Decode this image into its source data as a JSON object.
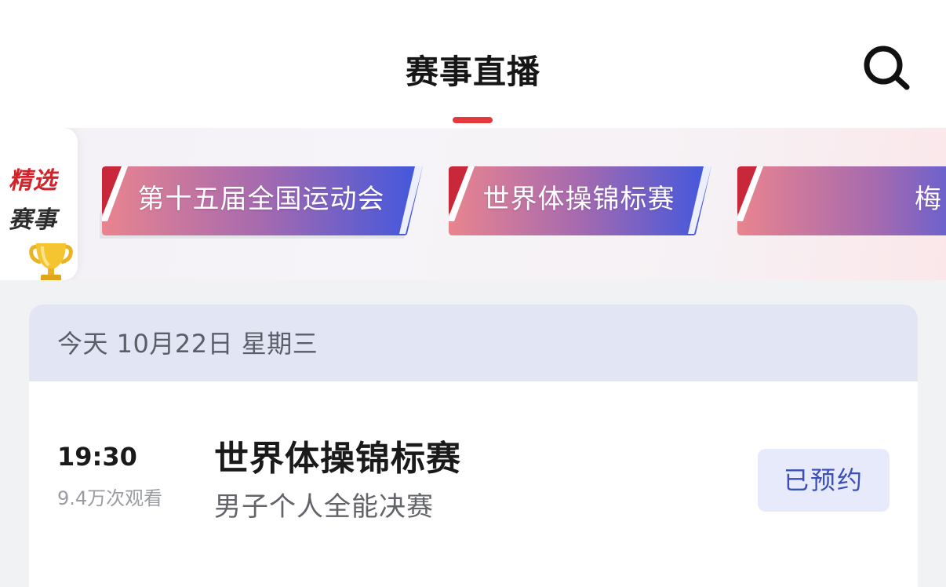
{
  "header": {
    "title": "赛事直播",
    "search_icon": "search-icon",
    "accent_color": "#e4393c"
  },
  "featured": {
    "badge_line_1": "精选",
    "badge_line_2": "赛事",
    "badge_icon": "trophy-icon",
    "events": [
      {
        "label": "第十五届全国运动会"
      },
      {
        "label": "世界体操锦标赛"
      },
      {
        "label": "梅"
      }
    ]
  },
  "schedule": {
    "date_label": "今天 10月22日 星期三",
    "matches": [
      {
        "time": "19:30",
        "views": "9.4万次观看",
        "title": "世界体操锦标赛",
        "subtitle": "男子个人全能决赛",
        "action_label": "已预约"
      }
    ]
  }
}
